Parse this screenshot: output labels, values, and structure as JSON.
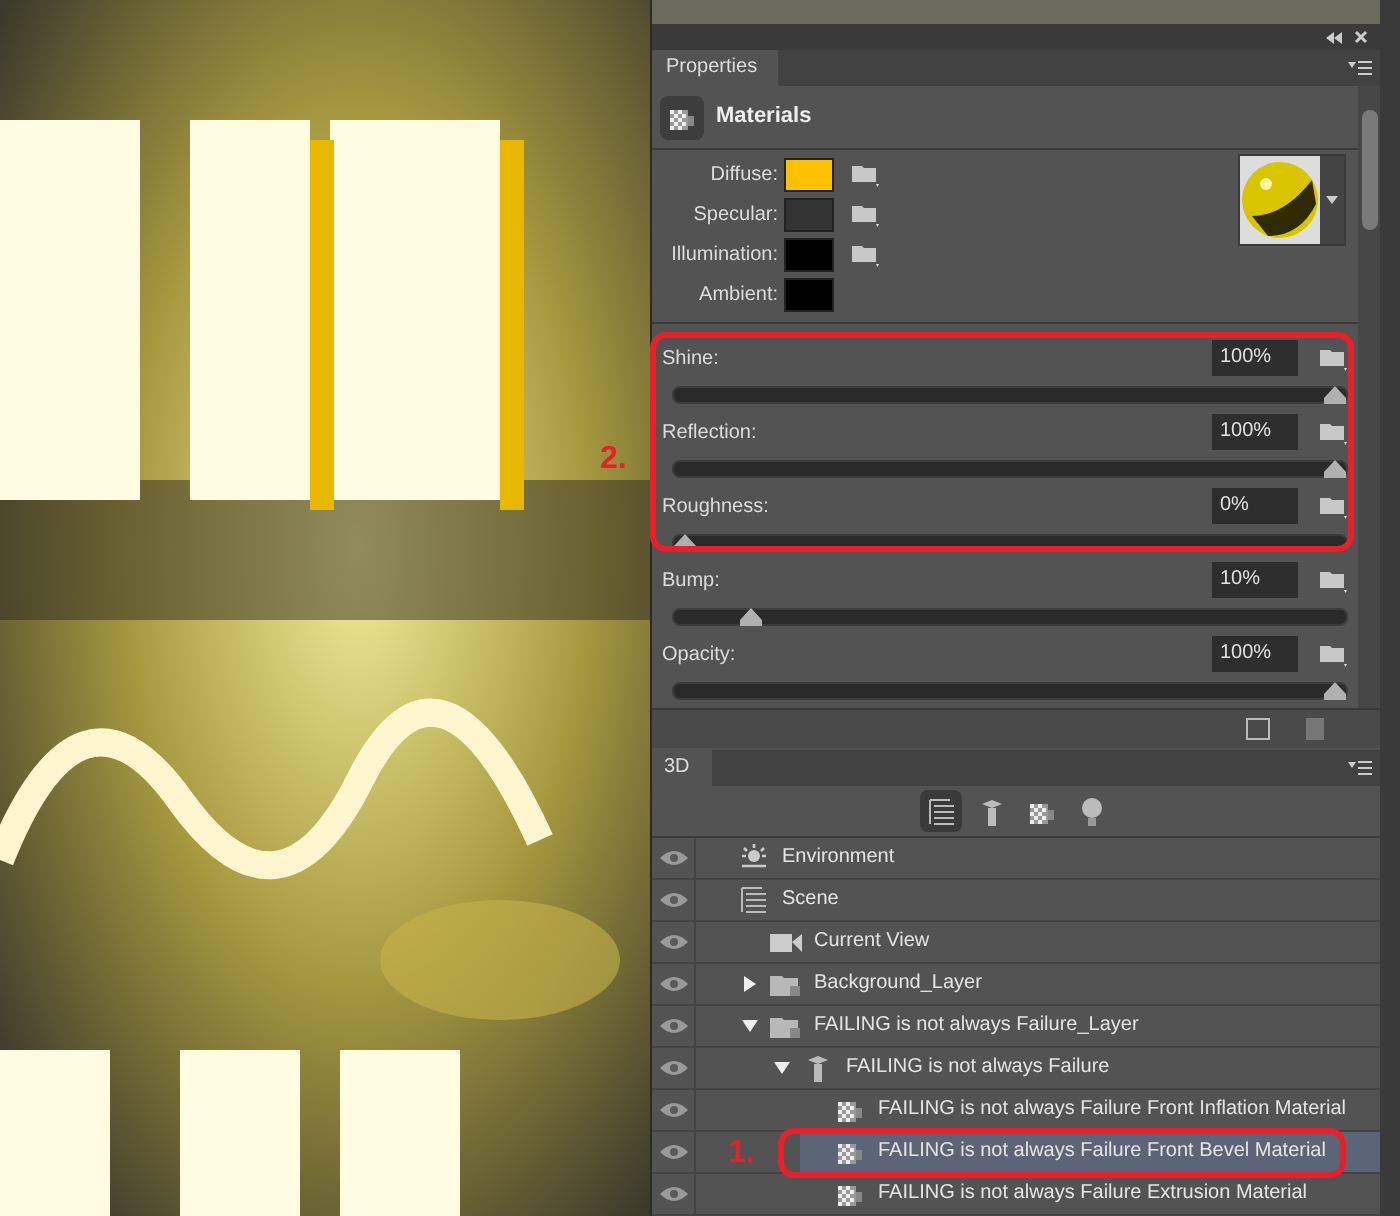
{
  "properties_panel": {
    "tab": "Properties",
    "header": "Materials",
    "swatches": [
      {
        "label": "Diffuse:",
        "color": "#ffc000",
        "texture": true
      },
      {
        "label": "Specular:",
        "color": "#333333",
        "texture": true
      },
      {
        "label": "Illumination:",
        "color": "#000000",
        "texture": true
      },
      {
        "label": "Ambient:",
        "color": "#000000",
        "texture": false
      }
    ],
    "sliders": [
      {
        "label": "Shine:",
        "value": "100%",
        "level": 1
      },
      {
        "label": "Reflection:",
        "value": "100%",
        "level": 1
      },
      {
        "label": "Roughness:",
        "value": "0%",
        "level": 0
      },
      {
        "label": "Bump:",
        "value": "10%",
        "level": 0.1
      },
      {
        "label": "Opacity:",
        "value": "100%",
        "level": 1
      }
    ]
  },
  "panel_3d": {
    "tab": "3D",
    "filters": [
      {
        "kind": "scene",
        "selected": true
      },
      {
        "kind": "mesh",
        "selected": false
      },
      {
        "kind": "material",
        "selected": false
      },
      {
        "kind": "light",
        "selected": false
      }
    ],
    "tree": [
      {
        "label": "Environment",
        "kind": "environment",
        "selected": false
      },
      {
        "label": "Scene",
        "kind": "scene",
        "selected": false,
        "children": [
          {
            "label": "Current View",
            "kind": "camera",
            "selected": false
          },
          {
            "label": "Background_Layer",
            "kind": "layer",
            "selected": false,
            "expanded": false
          },
          {
            "label": "FAILING is not always Failure_Layer",
            "kind": "layer",
            "selected": false,
            "expanded": true,
            "children": [
              {
                "label": "FAILING is not always Failure",
                "kind": "mesh",
                "selected": false,
                "expanded": true,
                "children": [
                  {
                    "label": "FAILING is not always Failure Front Inflation Material",
                    "kind": "material",
                    "selected": false
                  },
                  {
                    "label": "FAILING is not always Failure Front Bevel Material",
                    "kind": "material",
                    "selected": true
                  },
                  {
                    "label": "FAILING is not always Failure Extrusion Material",
                    "kind": "material",
                    "selected": false
                  }
                ]
              }
            ]
          }
        ]
      }
    ]
  },
  "annotations": [
    {
      "label": "2."
    },
    {
      "label": "1."
    }
  ]
}
